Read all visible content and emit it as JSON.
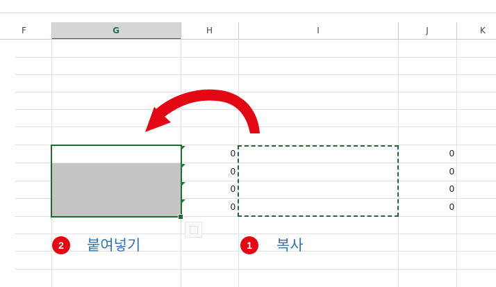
{
  "columns": [
    "F",
    "G",
    "H",
    "I",
    "J",
    "K"
  ],
  "selected_column": "G",
  "h_values": [
    "0",
    "0",
    "0",
    "0"
  ],
  "j_values": [
    "0",
    "0",
    "0",
    "0"
  ],
  "steps": [
    {
      "number": "2",
      "label": "붙여넣기"
    },
    {
      "number": "1",
      "label": "복사"
    }
  ],
  "colors": {
    "selection_border": "#1e6b33",
    "arrow": "#e30613",
    "badge": "#e30613",
    "step_label": "#2e74b5",
    "selected_fill": "#c4c4c4"
  },
  "icons": [
    "curved-arrow-icon",
    "paste-options-icon",
    "error-indicator-icon"
  ]
}
